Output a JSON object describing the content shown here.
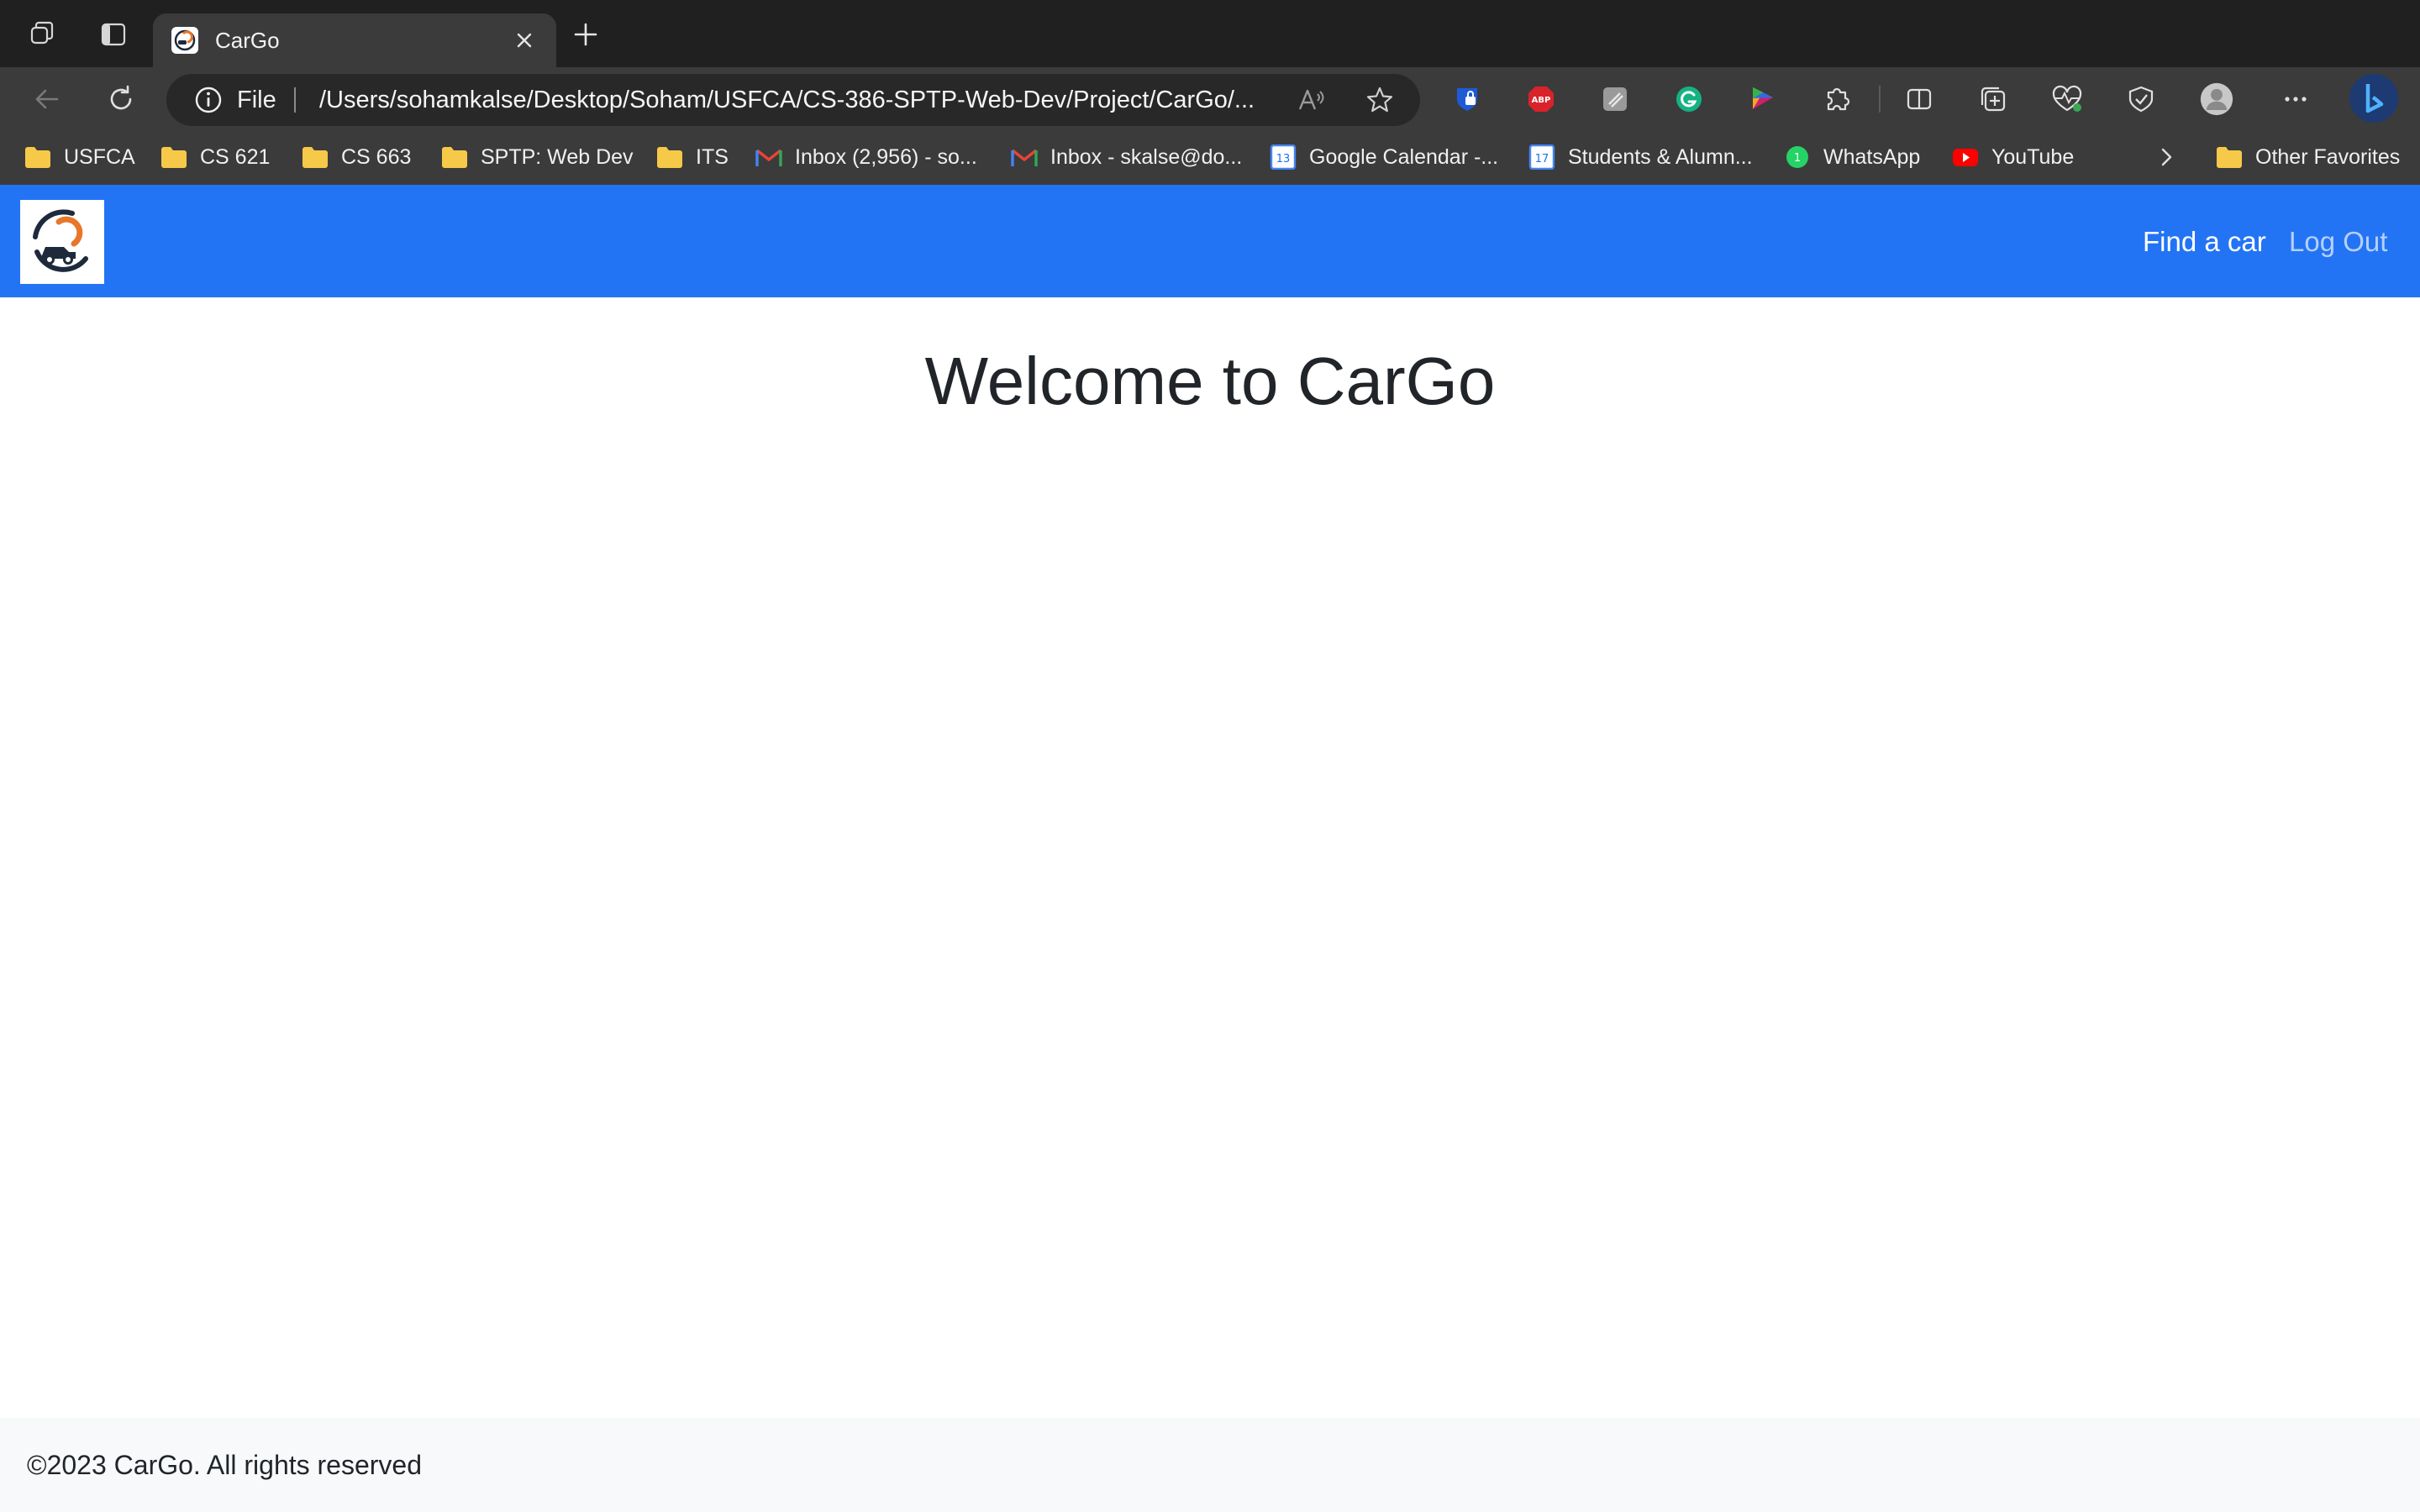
{
  "browser": {
    "tab": {
      "title": "CarGo"
    },
    "address_bar": {
      "scheme_label": "File",
      "url": "/Users/sohamkalse/Desktop/Soham/USFCA/CS-386-SPTP-Web-Dev/Project/CarGo/..."
    },
    "icons": {
      "workspaces": "workspaces-icon",
      "tab_actions": "tab-actions-icon",
      "new_tab": "plus-icon",
      "back": "back-arrow-icon",
      "refresh": "refresh-icon",
      "read_aloud": "read-aloud-icon",
      "favorite": "star-icon",
      "extensions": [
        "bitwarden-icon",
        "adblock-plus-icon",
        "extension-icon",
        "grammarly-icon",
        "color-picker-icon",
        "puzzle-icon"
      ],
      "split_screen": "split-screen-icon",
      "collections": "collections-icon",
      "performance": "performance-icon",
      "browser_essentials": "browser-essentials-icon",
      "profile": "profile-avatar-icon",
      "more": "more-icon",
      "copilot": "bing-icon"
    },
    "bookmarks": [
      {
        "label": "USFCA",
        "icon": "folder-icon"
      },
      {
        "label": "CS 621",
        "icon": "folder-icon"
      },
      {
        "label": "CS 663",
        "icon": "folder-icon"
      },
      {
        "label": "SPTP: Web Dev",
        "icon": "folder-icon"
      },
      {
        "label": "ITS",
        "icon": "folder-icon"
      },
      {
        "label": "Inbox (2,956) - so...",
        "icon": "gmail-icon"
      },
      {
        "label": "Inbox - skalse@do...",
        "icon": "gmail-icon"
      },
      {
        "label": "Google Calendar -...",
        "icon": "calendar-icon",
        "badge": "13"
      },
      {
        "label": "Students & Alumn...",
        "icon": "calendar-icon",
        "badge": "17"
      },
      {
        "label": "WhatsApp",
        "icon": "whatsapp-icon",
        "badge": "1"
      },
      {
        "label": "YouTube",
        "icon": "youtube-icon"
      }
    ],
    "other_favorites": {
      "label": "Other Favorites",
      "icon": "folder-icon"
    }
  },
  "page": {
    "nav": {
      "logo": "cargo-logo",
      "links": [
        {
          "label": "Find a car"
        },
        {
          "label": "Log Out"
        }
      ]
    },
    "heading": "Welcome to CarGo",
    "footer": {
      "copyright": "©2023 CarGo. All rights reserved"
    }
  },
  "colors": {
    "navbar": "#2374f4",
    "tab_strip": "#202020",
    "toolbar": "#3b3b3b",
    "heading_text": "#212529",
    "logo_orange": "#e8762b",
    "logo_navy": "#1e2a3c"
  }
}
